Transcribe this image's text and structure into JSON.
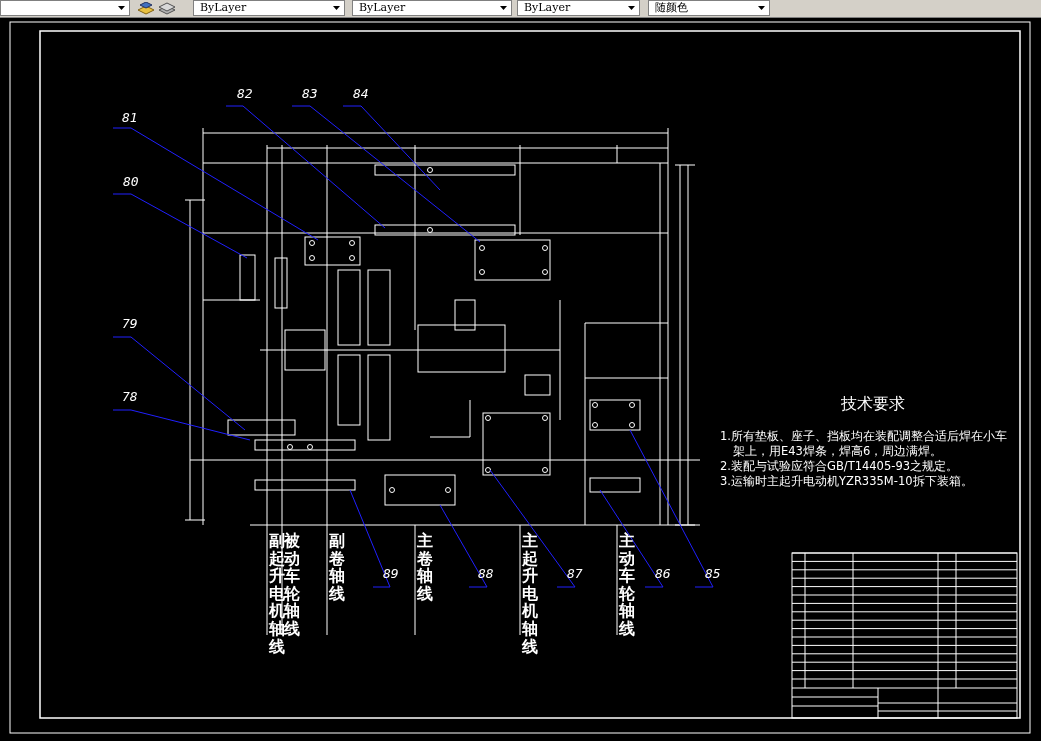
{
  "toolbar": {
    "dropdowns": [
      {
        "value": "ByLayer"
      },
      {
        "value": "ByLayer"
      },
      {
        "value": "ByLayer"
      },
      {
        "value": "随颜色"
      }
    ]
  },
  "drawing": {
    "balloons": [
      {
        "label": "81"
      },
      {
        "label": "82"
      },
      {
        "label": "83"
      },
      {
        "label": "84"
      },
      {
        "label": "80"
      },
      {
        "label": "79"
      },
      {
        "label": "78"
      },
      {
        "label": "89"
      },
      {
        "label": "88"
      },
      {
        "label": "87"
      },
      {
        "label": "86"
      },
      {
        "label": "85"
      }
    ],
    "axis_labels": [
      "副起升电机轴线",
      "被动车轮轴线",
      "副卷轴线",
      "主卷轴线",
      "主起升电机轴线",
      "主动车轮轴线"
    ],
    "requirements": {
      "title": "技术要求",
      "items": [
        "1.所有垫板、座子、挡板均在装配调整合适后焊在小车架上，用E43焊条，焊高6，周边满焊。",
        "2.装配与试验应符合GB/T14405-93之规定。",
        "3.运输时主起升电动机YZR335M-10拆下装箱。"
      ]
    }
  }
}
